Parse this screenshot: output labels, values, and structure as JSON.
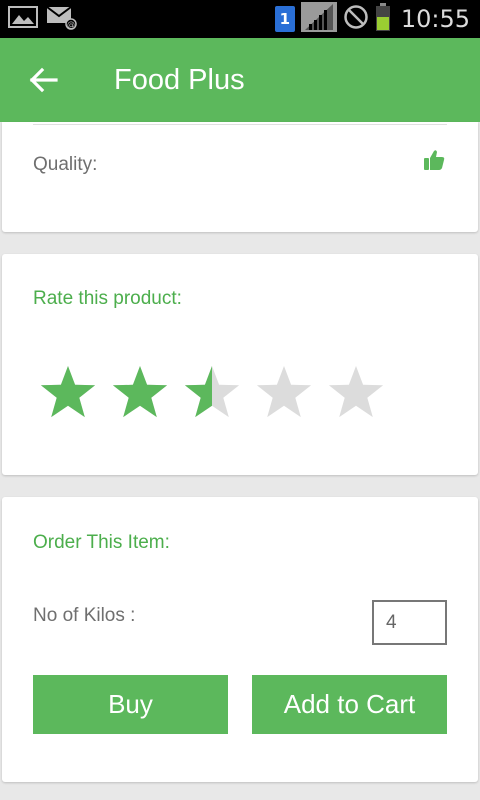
{
  "status_bar": {
    "time": "10:55",
    "sim_slot": "1",
    "icons": [
      "gallery-icon",
      "email-icon",
      "sim-icon",
      "signal-icon",
      "blocked-icon",
      "battery-icon"
    ]
  },
  "app_bar": {
    "title": "Food Plus",
    "back_icon": "arrow-left-icon",
    "color": "#5cb85c"
  },
  "quality": {
    "label": "Quality:",
    "icon": "thumbs-up-icon"
  },
  "rating": {
    "label": "Rate this product:",
    "value": 2.5,
    "max": 5,
    "filled_color": "#5cb85c",
    "empty_color": "#dcdcdc"
  },
  "order": {
    "label": "Order This Item:",
    "kilos_label": "No of Kilos :",
    "kilos_value": "4",
    "buy_label": "Buy",
    "cart_label": "Add to Cart"
  },
  "colors": {
    "accent": "#5cb85c",
    "accent_text": "#4cae4c",
    "background": "#e8e8e8"
  }
}
